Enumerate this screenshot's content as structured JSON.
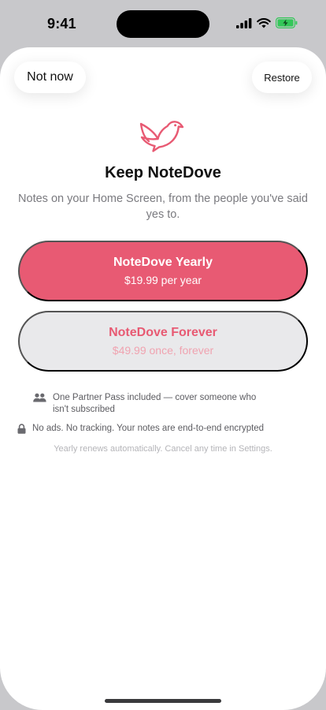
{
  "status_bar": {
    "time": "9:41",
    "icons": [
      "cellular-signal-icon",
      "wifi-icon",
      "battery-charging-icon"
    ]
  },
  "header": {
    "not_now_label": "Not now",
    "restore_label": "Restore"
  },
  "hero": {
    "logo_icon": "dove-icon",
    "title": "Keep NoteDove",
    "subtitle": "Notes on your Home Screen, from the people you've said yes to."
  },
  "plans": [
    {
      "name": "NoteDove Yearly",
      "price": "$19.99 per year",
      "selected": true
    },
    {
      "name": "NoteDove Forever",
      "price": "$49.99 once, forever",
      "selected": false
    }
  ],
  "features": [
    {
      "icon": "people-icon",
      "text": "One Partner Pass included — cover someone who isn't subscribed"
    },
    {
      "icon": "lock-icon",
      "text": "No ads. No tracking. Your notes are end-to-end encrypted"
    }
  ],
  "footnote": "Yearly renews automatically. Cancel any time in Settings.",
  "colors": {
    "accent": "#e85a73",
    "accent_light": "#f0a3b0",
    "secondary_fill": "#e9e9eb",
    "battery_green": "#34c759"
  }
}
